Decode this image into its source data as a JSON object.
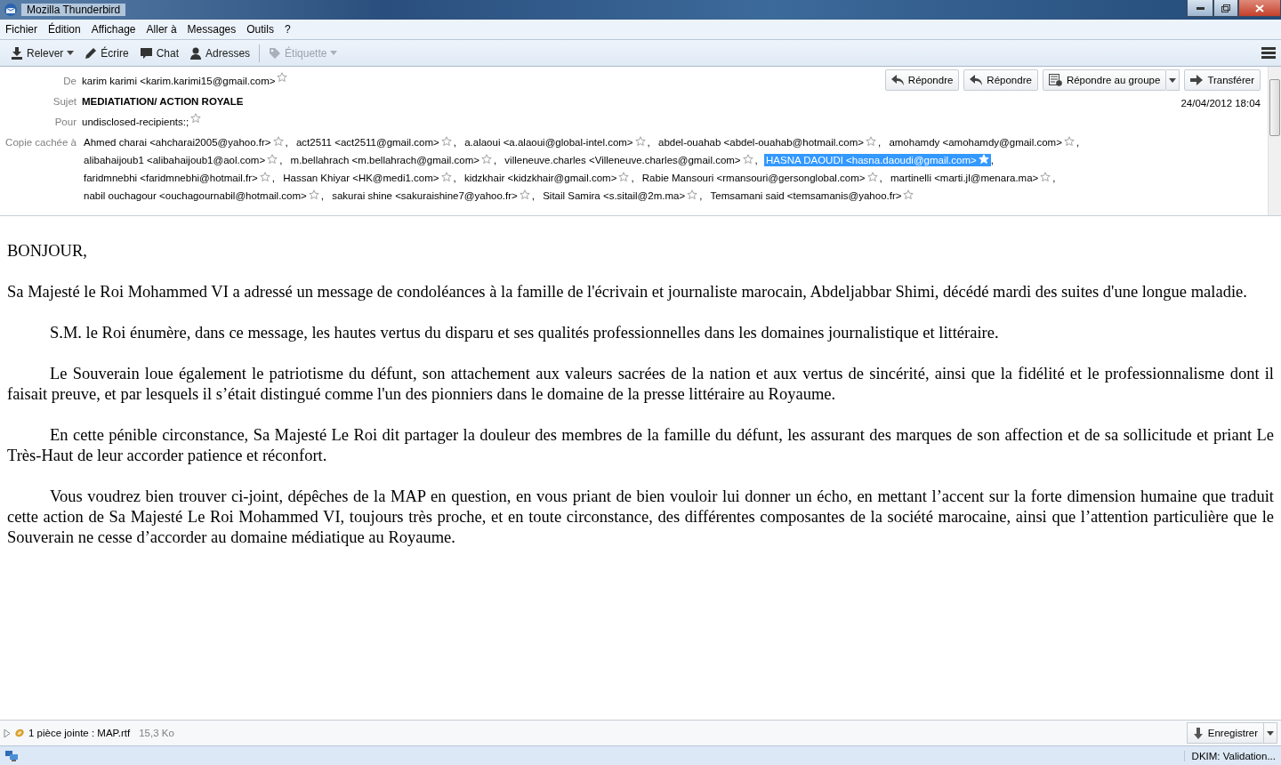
{
  "window": {
    "title": "Mozilla Thunderbird"
  },
  "menu": [
    {
      "label": "Fichier"
    },
    {
      "label": "Édition"
    },
    {
      "label": "Affichage"
    },
    {
      "label": "Aller à"
    },
    {
      "label": "Messages"
    },
    {
      "label": "Outils"
    },
    {
      "label": "?"
    }
  ],
  "toolbar": [
    {
      "label": "Relever",
      "dropdown": true,
      "disabled": false
    },
    {
      "label": "Écrire",
      "dropdown": false,
      "disabled": false
    },
    {
      "label": "Chat",
      "dropdown": false,
      "disabled": false
    },
    {
      "label": "Adresses",
      "dropdown": false,
      "disabled": false
    },
    {
      "label": "Étiquette",
      "dropdown": true,
      "disabled": true
    }
  ],
  "header": {
    "from": {
      "label": "De",
      "value": "karim karimi <karim.karimi15@gmail.com>"
    },
    "subject": {
      "label": "Sujet",
      "value": "MEDIATIATION/ ACTION ROYALE"
    },
    "to": {
      "label": "Pour",
      "value": "undisclosed-recipients:;"
    },
    "bcc": {
      "label": "Copie cachée à",
      "recipients": [
        {
          "name": "Ahmed charai <ahcharai2005@yahoo.fr>",
          "separator": ",",
          "selected": false
        },
        {
          "name": "act2511 <act2511@gmail.com>",
          "separator": ",",
          "selected": false
        },
        {
          "name": "a.alaoui <a.alaoui@global-intel.com>",
          "separator": ",",
          "selected": false
        },
        {
          "name": "abdel-ouahab <abdel-ouahab@hotmail.com>",
          "separator": ",",
          "selected": false
        },
        {
          "name": "amohamdy <amohamdy@gmail.com>",
          "separator": ",",
          "selected": false
        },
        {
          "name": "alibahaijoub1 <alibahaijoub1@aol.com>",
          "separator": ",",
          "selected": false
        },
        {
          "name": "m.bellahrach <m.bellahrach@gmail.com>",
          "separator": ",",
          "selected": false
        },
        {
          "name": "villeneuve.charles <Villeneuve.charles@gmail.com>",
          "separator": ",",
          "selected": false
        },
        {
          "name": "HASNA DAOUDI <hasna.daoudi@gmail.com>",
          "separator": ",",
          "selected": true
        },
        {
          "name": "faridmnebhi <faridmnebhi@hotmail.fr>",
          "separator": ",",
          "selected": false
        },
        {
          "name": "Hassan Khiyar <HK@medi1.com>",
          "separator": ",",
          "selected": false
        },
        {
          "name": "kidzkhair <kidzkhair@gmail.com>",
          "separator": ",",
          "selected": false
        },
        {
          "name": "Rabie Mansouri <rmansouri@gersonglobal.com>",
          "separator": ",",
          "selected": false
        },
        {
          "name": "martinelli <marti.jl@menara.ma>",
          "separator": ",",
          "selected": false
        },
        {
          "name": "nabil ouchagour <ouchagournabil@hotmail.com>",
          "separator": ",",
          "selected": false
        },
        {
          "name": "sakurai shine <sakuraishine7@yahoo.fr>",
          "separator": ",",
          "selected": false
        },
        {
          "name": "Sitail Samira <s.sitail@2m.ma>",
          "separator": ",",
          "selected": false
        },
        {
          "name": "Temsamani said <temsamanis@yahoo.fr>",
          "selected": false
        }
      ]
    },
    "actions": [
      {
        "label": "Répondre",
        "dropdown": false
      },
      {
        "label": "Répondre",
        "dropdown": false
      },
      {
        "label": "Répondre au groupe",
        "dropdown": true
      },
      {
        "label": "Transférer",
        "dropdown": false
      }
    ],
    "date": "24/04/2012 18:04"
  },
  "body": [
    {
      "text": "BONJOUR,",
      "indented": false
    },
    {
      "text": "Sa Majesté le Roi Mohammed VI a adressé un message de condoléances à la famille de l'écrivain et journaliste marocain, Abdeljabbar Shimi, décédé mardi des suites d'une longue maladie.",
      "indented": false
    },
    {
      "text": "S.M. le Roi énumère, dans ce message, les hautes vertus du disparu et ses qualités professionnelles dans les domaines journalistique et littéraire.",
      "indented": true
    },
    {
      "text": "Le Souverain loue également le patriotisme du défunt, son attachement aux valeurs sacrées de la nation et aux vertus de sincérité, ainsi que la fidélité et le  professionnalisme dont il faisait preuve, et par lesquels il s’était distingué comme l'un des pionniers dans le domaine de la presse littéraire au Royaume.",
      "indented": true
    },
    {
      "text": "En cette pénible circonstance, Sa Majesté Le Roi dit partager la douleur des membres de la famille du défunt, les assurant des marques de son affection et de sa sollicitude et priant Le Très-Haut de leur accorder patience et réconfort.",
      "indented": true
    },
    {
      "text": "Vous voudrez bien trouver ci-joint, dépêches de la MAP en question, en vous priant de bien vouloir lui donner un écho, en mettant l’accent sur la forte dimension humaine que traduit cette action de Sa Majesté Le Roi Mohammed VI, toujours très proche, et en toute circonstance, des différentes composantes de la société marocaine, ainsi que l’attention particulière que le Souverain ne cesse d’accorder au domaine médiatique au Royaume.",
      "indented": true
    }
  ],
  "attachments": {
    "expanded": false,
    "summary": "1 pièce jointe : MAP.rtf",
    "size": "15,3 Ko",
    "save": "Enregistrer"
  },
  "status_bar": {
    "text": "DKIM: Validation..."
  }
}
